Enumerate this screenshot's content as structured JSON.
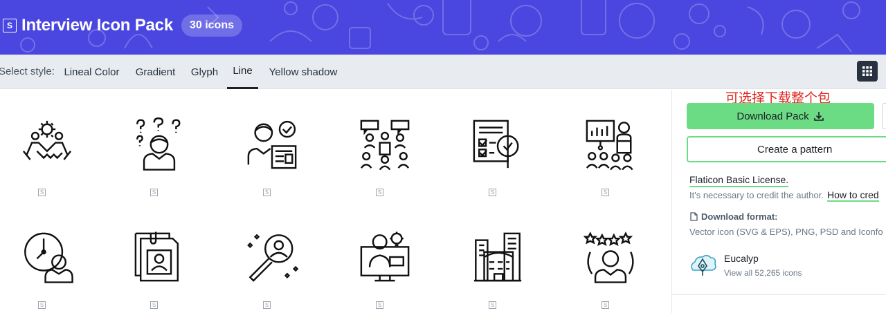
{
  "header": {
    "badge_letter": "S",
    "title": "Interview Icon Pack",
    "count": "30 icons",
    "background_color": "#4a47e0"
  },
  "style_bar": {
    "label": "Select style:",
    "tabs": [
      {
        "label": "Lineal Color",
        "active": false
      },
      {
        "label": "Gradient",
        "active": false
      },
      {
        "label": "Glyph",
        "active": false
      },
      {
        "label": "Line",
        "active": true
      },
      {
        "label": "Yellow shadow",
        "active": false
      }
    ],
    "grid_button_icon": "grid-icon"
  },
  "icons": [
    {
      "icon": "teamwork-handshake-icon",
      "badge": "S"
    },
    {
      "icon": "confused-person-icon",
      "badge": "S"
    },
    {
      "icon": "candidate-approved-icon",
      "badge": "S"
    },
    {
      "icon": "organization-chart-icon",
      "badge": "S"
    },
    {
      "icon": "checklist-search-icon",
      "badge": "S"
    },
    {
      "icon": "presentation-icon",
      "badge": "S"
    },
    {
      "icon": "time-management-icon",
      "badge": "S"
    },
    {
      "icon": "resume-document-icon",
      "badge": "S"
    },
    {
      "icon": "search-candidate-icon",
      "badge": "S"
    },
    {
      "icon": "online-interview-icon",
      "badge": "S"
    },
    {
      "icon": "office-building-icon",
      "badge": "S"
    },
    {
      "icon": "star-rating-person-icon",
      "badge": "S"
    }
  ],
  "sidebar": {
    "annotation": "可选择下载整个包",
    "annotation_color": "#e0231c",
    "download_label": "Download Pack",
    "pattern_label": "Create a pattern",
    "license_label": "Flaticon Basic License.",
    "credit_text": "It's necessary to credit the author.",
    "credit_link": "How to cred",
    "format_title": "Download format:",
    "format_desc": "Vector icon (SVG & EPS), PNG, PSD and Iconfo",
    "author_name": "Eucalyp",
    "author_count": "View all 52,265 icons",
    "accent_color": "#6bdc84"
  }
}
